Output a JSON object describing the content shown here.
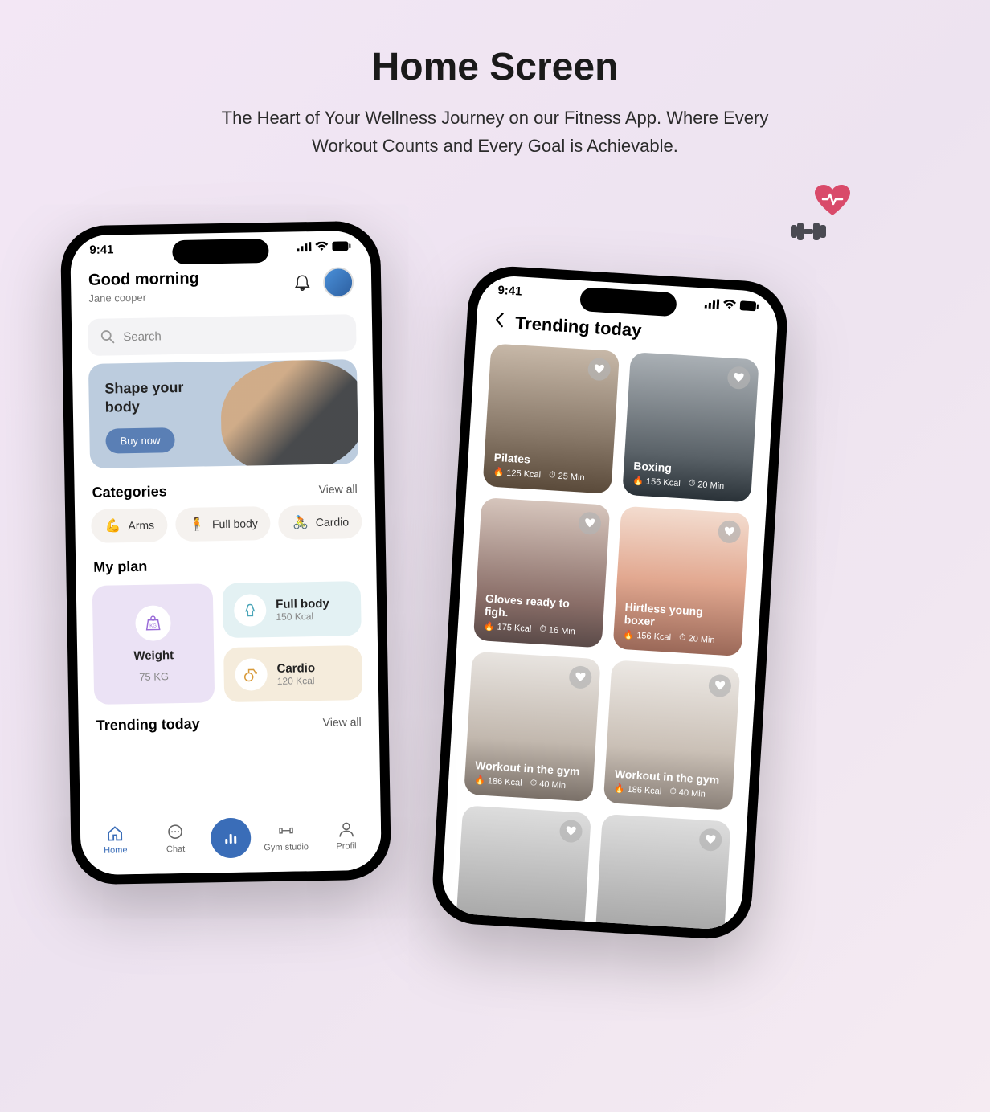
{
  "page": {
    "title": "Home Screen",
    "subtitle": "The Heart of Your Wellness Journey on our Fitness App. Where Every Workout Counts and Every Goal is Achievable."
  },
  "status": {
    "time": "9:41"
  },
  "phone1": {
    "greeting": "Good morning",
    "username": "Jane cooper",
    "search_placeholder": "Search",
    "promo": {
      "title": "Shape your body",
      "button": "Buy now"
    },
    "categories": {
      "title": "Categories",
      "view_all": "View all",
      "items": [
        {
          "label": "Arms",
          "icon": "💪"
        },
        {
          "label": "Full body",
          "icon": "🧍"
        },
        {
          "label": "Cardio",
          "icon": "🚴"
        }
      ]
    },
    "plan": {
      "title": "My plan",
      "weight": {
        "label": "Weight",
        "value": "75 KG"
      },
      "fullbody": {
        "label": "Full body",
        "value": "150 Kcal"
      },
      "cardio": {
        "label": "Cardio",
        "value": "120 Kcal"
      }
    },
    "trending_title": "Trending today",
    "trending_view_all": "View all",
    "nav": {
      "home": "Home",
      "chat": "Chat",
      "gym": "Gym studio",
      "profile": "Profil"
    }
  },
  "phone2": {
    "title": "Trending today",
    "cards": [
      {
        "title": "Pilates",
        "kcal": "125 Kcal",
        "min": "25 Min"
      },
      {
        "title": "Boxing",
        "kcal": "156 Kcal",
        "min": "20 Min"
      },
      {
        "title": "Gloves ready to figh.",
        "kcal": "175 Kcal",
        "min": "16 Min"
      },
      {
        "title": "Hirtless young boxer",
        "kcal": "156 Kcal",
        "min": "20 Min"
      },
      {
        "title": "Workout in the gym",
        "kcal": "186 Kcal",
        "min": "40 Min"
      },
      {
        "title": "Workout in the gym",
        "kcal": "186 Kcal",
        "min": "40 Min"
      }
    ]
  }
}
